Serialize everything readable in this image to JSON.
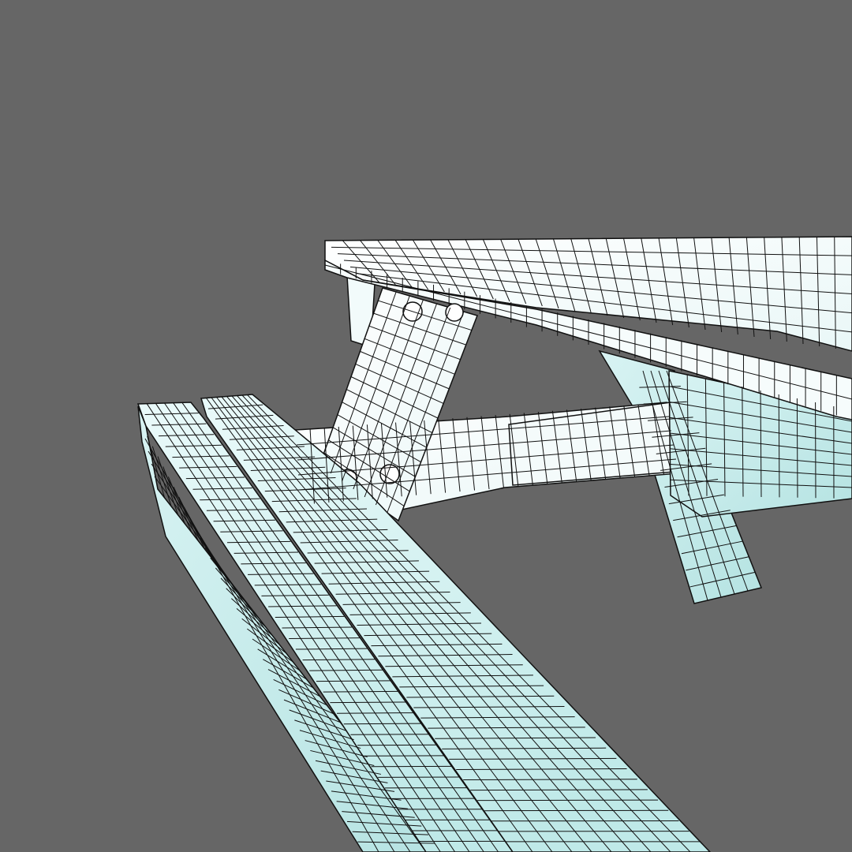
{
  "scene": {
    "background": "#666666",
    "subject": "picnic-table-wireframe",
    "wire_color": "#111111",
    "face_top": "#ffffff",
    "face_shade": "#cfeeed",
    "face_deep": "#a9dcdc"
  }
}
